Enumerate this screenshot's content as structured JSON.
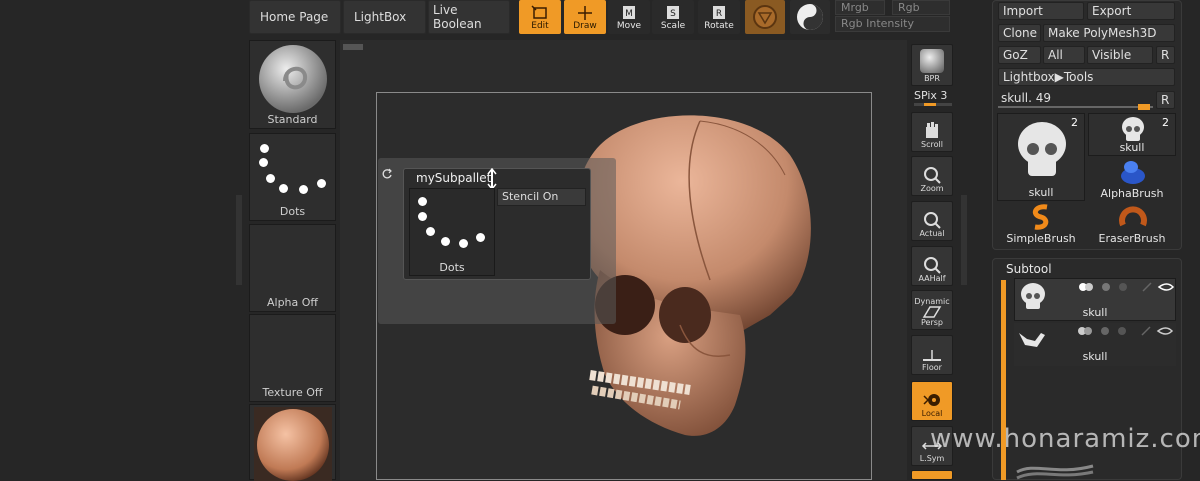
{
  "header": {
    "nav": [
      "Home Page",
      "LightBox",
      "Live Boolean"
    ],
    "tools": [
      "Edit",
      "Draw",
      "Move",
      "Scale",
      "Rotate"
    ],
    "color_fields": [
      "Mrgb",
      "Rgb",
      "Rgb Intensity"
    ]
  },
  "left_shelf": {
    "brush": "Standard",
    "stroke": "Dots",
    "alpha": "Alpha Off",
    "texture": "Texture Off"
  },
  "subpalette": {
    "title": "mySubpallet",
    "stencil_label": "Stencil On",
    "stroke_label": "Dots"
  },
  "right_shelf": {
    "bpr": "BPR",
    "spix": "SPix 3",
    "buttons": [
      "Scroll",
      "Zoom",
      "Actual",
      "AAHalf",
      "Persp",
      "Floor",
      "Local",
      "L.Sym"
    ],
    "dynamic": "Dynamic"
  },
  "tool_palette": {
    "import": "Import",
    "export": "Export",
    "clone": "Clone",
    "make_polymesh": "Make PolyMesh3D",
    "goz": "GoZ",
    "all": "All",
    "visible": "Visible",
    "r": "R",
    "lightbox_tools": "Lightbox▶Tools",
    "current_tool": "skull. 49",
    "thumbs": [
      {
        "name": "skull",
        "count": "2"
      },
      {
        "name": "skull",
        "count": "2"
      },
      {
        "name": "AlphaBrush"
      },
      {
        "name": "SimpleBrush"
      },
      {
        "name": "EraserBrush"
      }
    ]
  },
  "subtool": {
    "title": "Subtool",
    "items": [
      "skull",
      "skull"
    ]
  },
  "watermark": "www.honaramiz.com",
  "colors": {
    "accent": "#f09a26",
    "background": "#262626",
    "skull": "#c48a6c"
  }
}
